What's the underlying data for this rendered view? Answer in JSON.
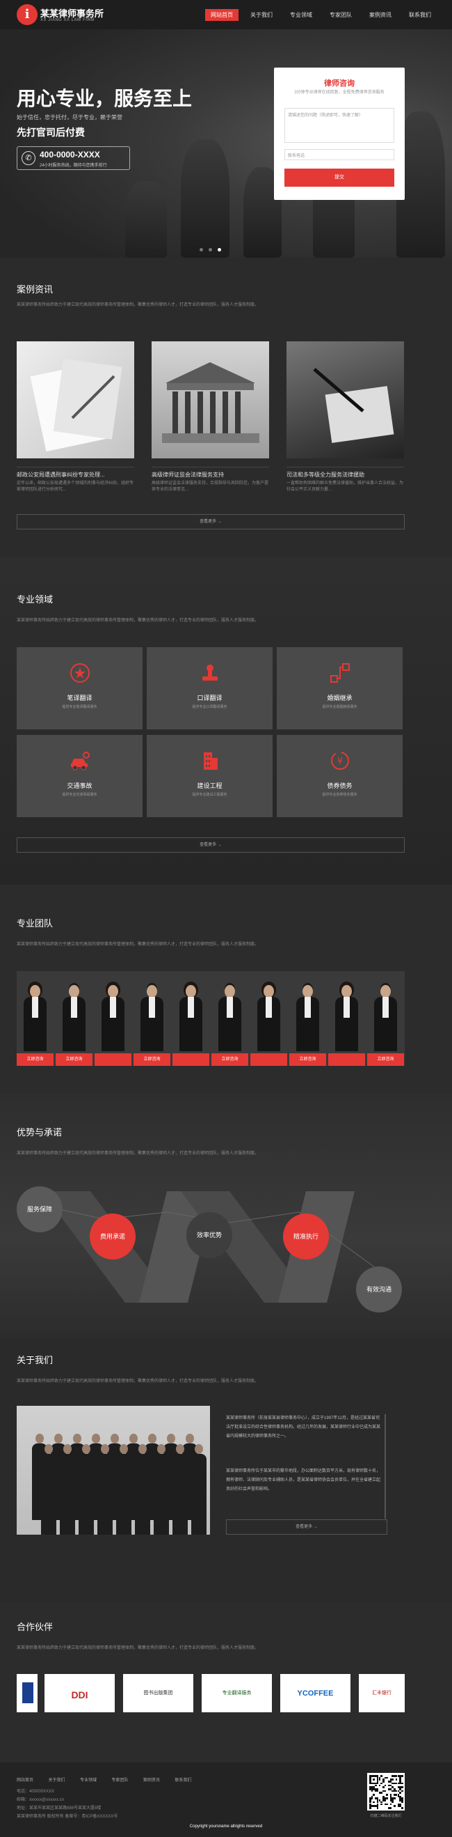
{
  "header": {
    "logo_glyph": "i",
    "logo_title": "某某律师事务所",
    "logo_sub": "XX JIANG XX LAW FIRM",
    "nav": [
      "网站首页",
      "关于我们",
      "专业领域",
      "专家团队",
      "案例资讯",
      "联系我们"
    ]
  },
  "hero": {
    "title": "用心专业，服务至上",
    "desc": "始于信任，忠于托付，尽于专业，赖于荣誉",
    "subtitle": "先打官司后付费",
    "phone": "400-0000-XXXX",
    "phone_note": "24小时服务热线，期待与您携手前行"
  },
  "consult": {
    "title": "律师咨询",
    "subtitle": "3分钟专业律师在线回复，全程免费律师咨询服务",
    "area_placeholder": "请描述您的问题（简述即可，快速了解）",
    "input_placeholder": "联系电话",
    "button": "提交"
  },
  "cases": {
    "title": "案例资讯",
    "desc": "某某律师事务所始终致力于建立现代高效的律师事务所管理体制，聚集优秀的律师人才，打造专业的律师团队，服务人才服务制度。",
    "items": [
      {
        "title": "邮政公安局遭遇刑事纠纷专家处理...",
        "desc": "近年以来，邮政公安局遭遇多个领域的刑事与经济纠纷，组织专家律师团队进行分析研究..."
      },
      {
        "title": "高级律师证监会法律服务支持",
        "desc": "高级律师证监会法律服务支持，合规指导与风险防范，为客户提供专业的法律意见..."
      },
      {
        "title": "司法和多等级全力服务法律援助",
        "desc": "一直帮助有困难的群众免费法律援助，维护当事人合法权益，为社会公平正义贡献力量..."
      }
    ],
    "more": "查看更多 →"
  },
  "fields": {
    "title": "专业领域",
    "desc": "某某律师事务所始终致力于建立现代高效的律师事务所管理体制，聚集优秀的律师人才，打造专业的律师团队，服务人才服务制度。",
    "items": [
      {
        "name": "笔译翻译",
        "desc": "提供专业笔译翻译服务",
        "icon": "star-badge-icon"
      },
      {
        "name": "口译翻译",
        "desc": "提供专业口译翻译服务",
        "icon": "stamp-icon"
      },
      {
        "name": "婚姻继承",
        "desc": "提供专业婚姻继承服务",
        "icon": "network-icon"
      },
      {
        "name": "交通事故",
        "desc": "提供专业交通事故服务",
        "icon": "car-icon"
      },
      {
        "name": "建设工程",
        "desc": "提供专业建设工程服务",
        "icon": "building-icon"
      },
      {
        "name": "债券债务",
        "desc": "提供专业债券债务服务",
        "icon": "yuan-icon"
      }
    ],
    "more": "查看更多 →"
  },
  "team": {
    "title": "专业团队",
    "desc": "某某律师事务所始终致力于建立现代高效的律师事务所管理体制，聚集优秀的律师人才，打造专业的律师团队，服务人才服务制度。",
    "button": "立即咨询"
  },
  "advantages": {
    "title": "优势与承诺",
    "desc": "某某律师事务所始终致力于建立现代高效的律师事务所管理体制，聚集优秀的律师人才，打造专业的律师团队，服务人才服务制度。",
    "items": [
      "服务保障",
      "费用承诺",
      "效率优势",
      "精准执行",
      "有效沟通"
    ]
  },
  "about": {
    "title": "关于我们",
    "desc": "某某律师事务所始终致力于建立现代高效的律师事务所管理体制，聚集优秀的律师人才，打造专业的律师团队，服务人才服务制度。",
    "text1": "某某律师事务所（前身某某县律师事务中心），成立于1997年12月，是经过某某省司法厅批准设立的综合性律师事务机构。经过几年的发展，某某律师行业中已成为某某省内规模较大的律师事务所之一。",
    "text2": "某某律师事务所位于某某市的繁华地段，办公面积达数百平方米，现有律师数十名，拥有律师、法律顾问及专业辅助人员，是某某省律师协会会员单位，并在全省建立起良好的社会声誉和影响。",
    "more": "查看更多 →"
  },
  "partners": {
    "title": "合作伙伴",
    "desc": "某某律师事务所始终致力于建立现代高效的律师事务所管理体制，聚集优秀的律师人才，打造专业的律师团队，服务人才服务制度。",
    "items": [
      "",
      "DDI",
      "图书出版集团",
      "专业翻译服务",
      "YCOFFEE",
      "汇丰银行"
    ]
  },
  "footer": {
    "nav": [
      "网站首页",
      "关于我们",
      "专业领域",
      "专家团队",
      "案例资讯",
      "联系我们"
    ],
    "phone": "电话：400000XXXX",
    "email": "邮箱：xxxxxx@xxxxxx.cn",
    "address": "地址：某某市某某区某某路888号某某大厦8楼",
    "legal": "某某律师事务所 版权所有 备案号：粤ICP备XXXXXX号",
    "qr_note": "扫描二维码关注我们",
    "copyright": "Copyright yoursname allrights reserved"
  },
  "colors": {
    "accent": "#e53935",
    "bg": "#2a2a2a"
  }
}
